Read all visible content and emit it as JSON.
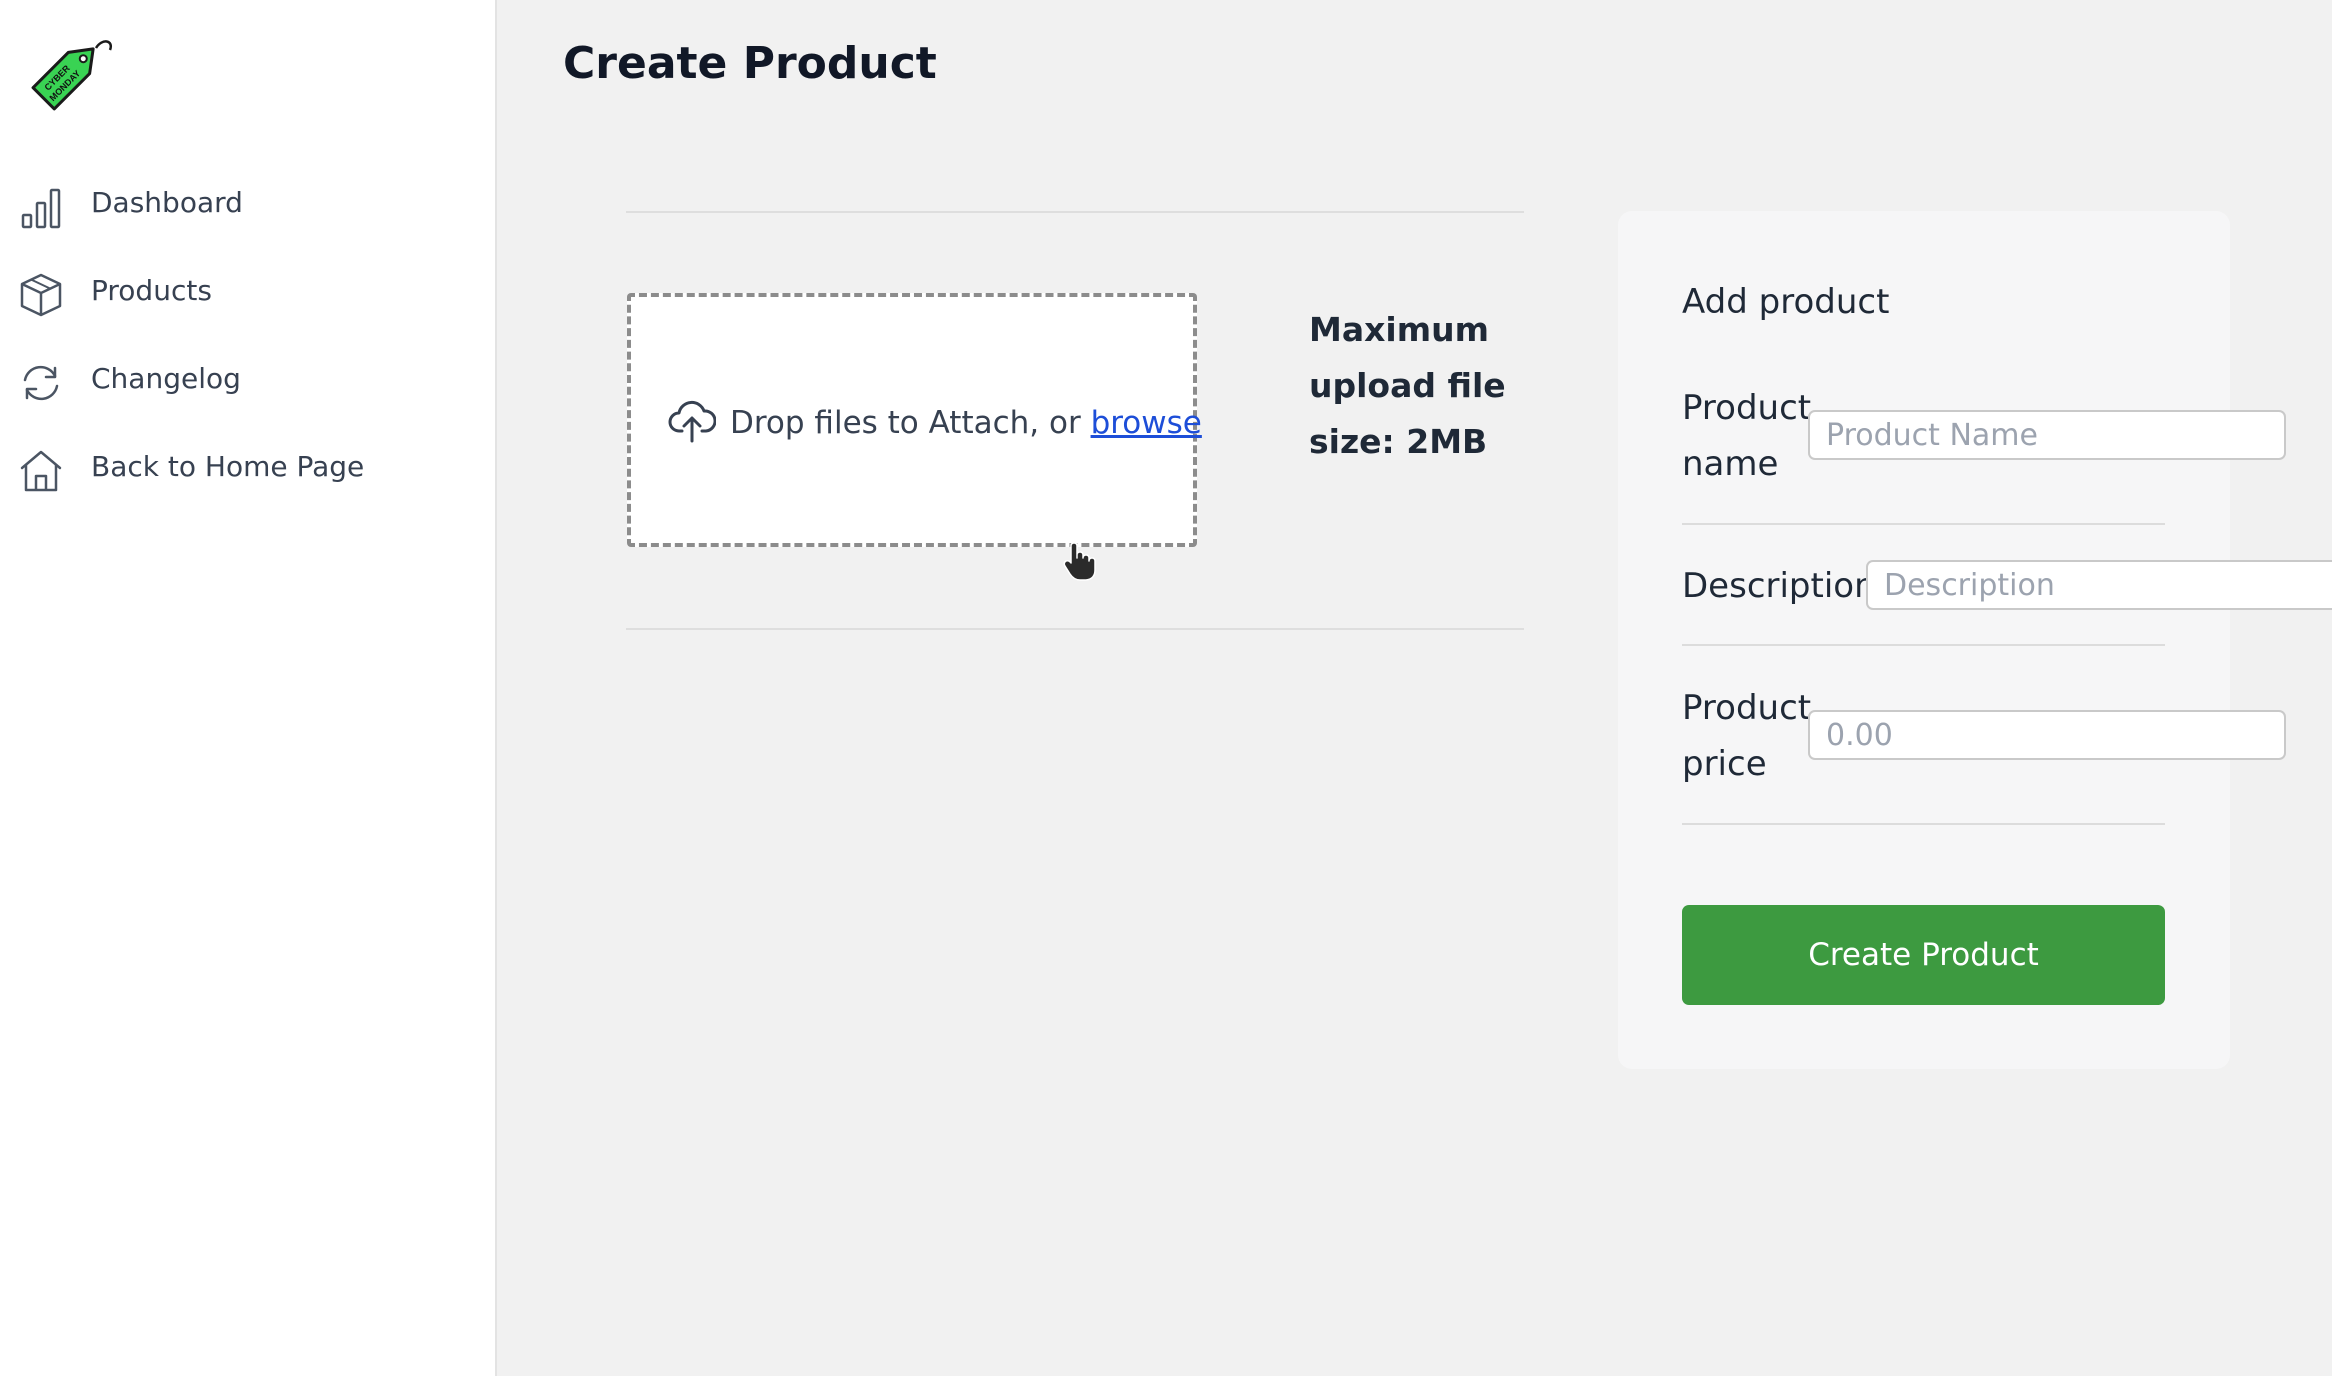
{
  "logo": {
    "alt": "Cyber Monday",
    "text_line1": "CYBER",
    "text_line2": "MONDAY",
    "color": "#39d353"
  },
  "sidebar": {
    "items": [
      {
        "label": "Dashboard",
        "icon": "bar-chart-icon"
      },
      {
        "label": "Products",
        "icon": "box-icon"
      },
      {
        "label": "Changelog",
        "icon": "refresh-icon"
      },
      {
        "label": "Back to Home Page",
        "icon": "home-icon"
      }
    ]
  },
  "page": {
    "title": "Create Product"
  },
  "upload": {
    "drop_text": "Drop files to Attach, or ",
    "browse_label": "browse",
    "max_size_note": "Maximum upload file size: 2MB",
    "icon": "cloud-upload-icon"
  },
  "form": {
    "title": "Add product",
    "fields": {
      "name": {
        "label": "Product name",
        "placeholder": "Product Name",
        "value": ""
      },
      "description": {
        "label": "Description",
        "placeholder": "Description",
        "value": ""
      },
      "price": {
        "label": "Product price",
        "placeholder": "0.00",
        "value": ""
      }
    },
    "submit_label": "Create Product",
    "submit_color": "#3d9a40"
  }
}
